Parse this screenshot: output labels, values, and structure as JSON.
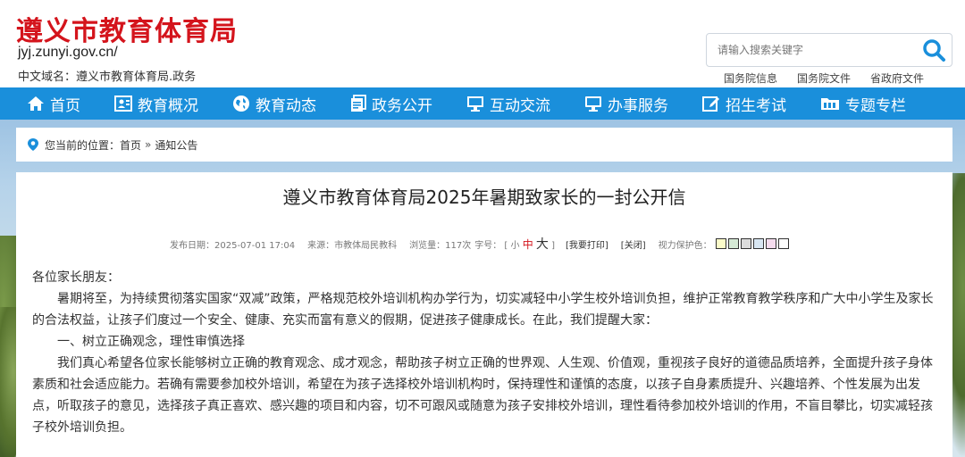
{
  "header": {
    "title": "遵义市教育体育局",
    "domain": "jyj.zunyi.gov.cn/",
    "cn_domain": "中文域名：遵义市教育体育局.政务",
    "search_placeholder": "请输入搜索关键字",
    "quick_links": [
      "国务院信息",
      "国务院文件",
      "省政府文件"
    ]
  },
  "nav": {
    "items": [
      {
        "label": "首页",
        "icon": "home-icon"
      },
      {
        "label": "教育概况",
        "icon": "profile-icon"
      },
      {
        "label": "教育动态",
        "icon": "globe-icon"
      },
      {
        "label": "政务公开",
        "icon": "document-icon"
      },
      {
        "label": "互动交流",
        "icon": "monitor-icon"
      },
      {
        "label": "办事服务",
        "icon": "desktop-icon"
      },
      {
        "label": "招生考试",
        "icon": "edit-icon"
      },
      {
        "label": "专题专栏",
        "icon": "folder-icon"
      }
    ]
  },
  "breadcrumb": {
    "prefix": "您当前的位置：",
    "items": [
      "首页",
      "通知公告"
    ],
    "separator": "»"
  },
  "article": {
    "title": "遵义市教育体育局2025年暑期致家长的一封公开信",
    "publish_date": "发布日期：2025-07-01 17:04",
    "source": "来源：市教体局民教科",
    "views": "浏览量：117次",
    "font_size_label": "字号：",
    "font_size_open": "[",
    "font_size_small": "小",
    "font_size_medium": "中",
    "font_size_large": "大",
    "font_size_close": "]",
    "print_label": "[我要打印]",
    "close_label": "[关闭]",
    "eye_protect_label": "视力保护色：",
    "eye_colors": [
      "#fbfbc9",
      "#d6ead6",
      "#dcdcdc",
      "#d8e6f2",
      "#f5dcee",
      "#ffffff"
    ],
    "paragraphs": [
      "各位家长朋友：",
      "暑期将至，为持续贯彻落实国家“双减”政策，严格规范校外培训机构办学行为，切实减轻中小学生校外培训负担，维护正常教育教学秩序和广大中小学生及家长的合法权益，让孩子们度过一个安全、健康、充实而富有意义的假期，促进孩子健康成长。在此，我们提醒大家：",
      "一、树立正确观念，理性审慎选择",
      "我们真心希望各位家长能够树立正确的教育观念、成才观念，帮助孩子树立正确的世界观、人生观、价值观，重视孩子良好的道德品质培养，全面提升孩子身体素质和社会适应能力。若确有需要参加校外培训，希望在为孩子选择校外培训机构时，保持理性和谨慎的态度，以孩子自身素质提升、兴趣培养、个性发展为出发点，听取孩子的意见，选择孩子真正喜欢、感兴趣的项目和内容，切不可跟风或随意为孩子安排校外培训，理性看待参加校外培训的作用，不盲目攀比，切实减轻孩子校外培训负担。"
    ]
  },
  "colors": {
    "brand_red": "#d4141c",
    "nav_blue": "#1a8fdb",
    "search_blue": "#1a8fdb"
  }
}
